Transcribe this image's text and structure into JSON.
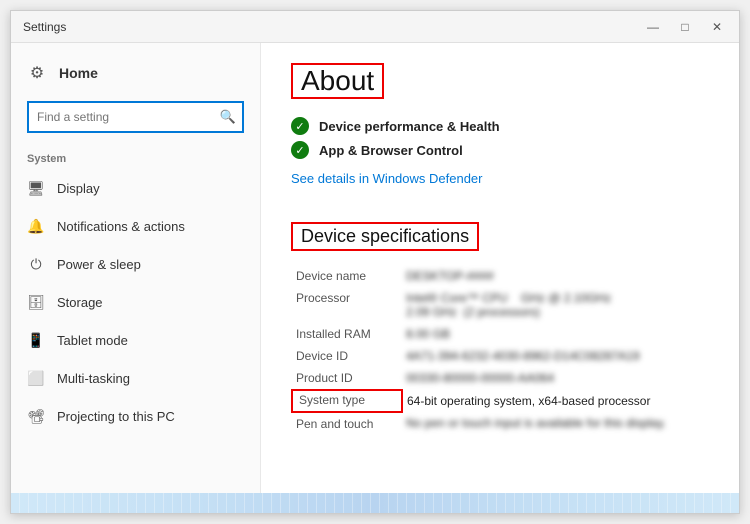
{
  "window": {
    "title": "Settings",
    "controls": {
      "minimize": "—",
      "maximize": "□",
      "close": "✕"
    }
  },
  "sidebar": {
    "home_label": "Home",
    "search_placeholder": "Find a setting",
    "section_label": "System",
    "items": [
      {
        "id": "display",
        "label": "Display",
        "icon": "🖥"
      },
      {
        "id": "notifications",
        "label": "Notifications & actions",
        "icon": "🔔"
      },
      {
        "id": "power",
        "label": "Power & sleep",
        "icon": "⏻"
      },
      {
        "id": "storage",
        "label": "Storage",
        "icon": "🗄"
      },
      {
        "id": "tablet",
        "label": "Tablet mode",
        "icon": "📱"
      },
      {
        "id": "multitasking",
        "label": "Multi-tasking",
        "icon": "⬜"
      },
      {
        "id": "projecting",
        "label": "Projecting to this PC",
        "icon": "📽"
      }
    ]
  },
  "main": {
    "page_title": "About",
    "security": {
      "items": [
        {
          "label": "Device performance & Health"
        },
        {
          "label": "App & Browser Control"
        }
      ],
      "link": "See details in Windows Defender"
    },
    "device_specs": {
      "title": "Device specifications",
      "rows": [
        {
          "label": "Device name",
          "value": "DESKTOP-ABC",
          "blurred": true
        },
        {
          "label": "Processor",
          "value": "Intel® Core™ CPU   GHz @ 2.10GHz\n2.09 GHz  (2 processors)",
          "blurred": true
        },
        {
          "label": "Installed RAM",
          "value": "8.00 GB",
          "blurred": true
        },
        {
          "label": "Device ID",
          "value": "4A71-394-6232-4030-8962-D14C08287A19",
          "blurred": true
        },
        {
          "label": "Product ID",
          "value": "00330-80000-00000-AA064",
          "blurred": true
        },
        {
          "label": "System type",
          "value": "64-bit operating system, x64-based processor",
          "blurred": false,
          "highlight": true
        },
        {
          "label": "Pen and touch",
          "value": "No pen or touch input is available for this display.",
          "blurred": true
        }
      ]
    }
  }
}
